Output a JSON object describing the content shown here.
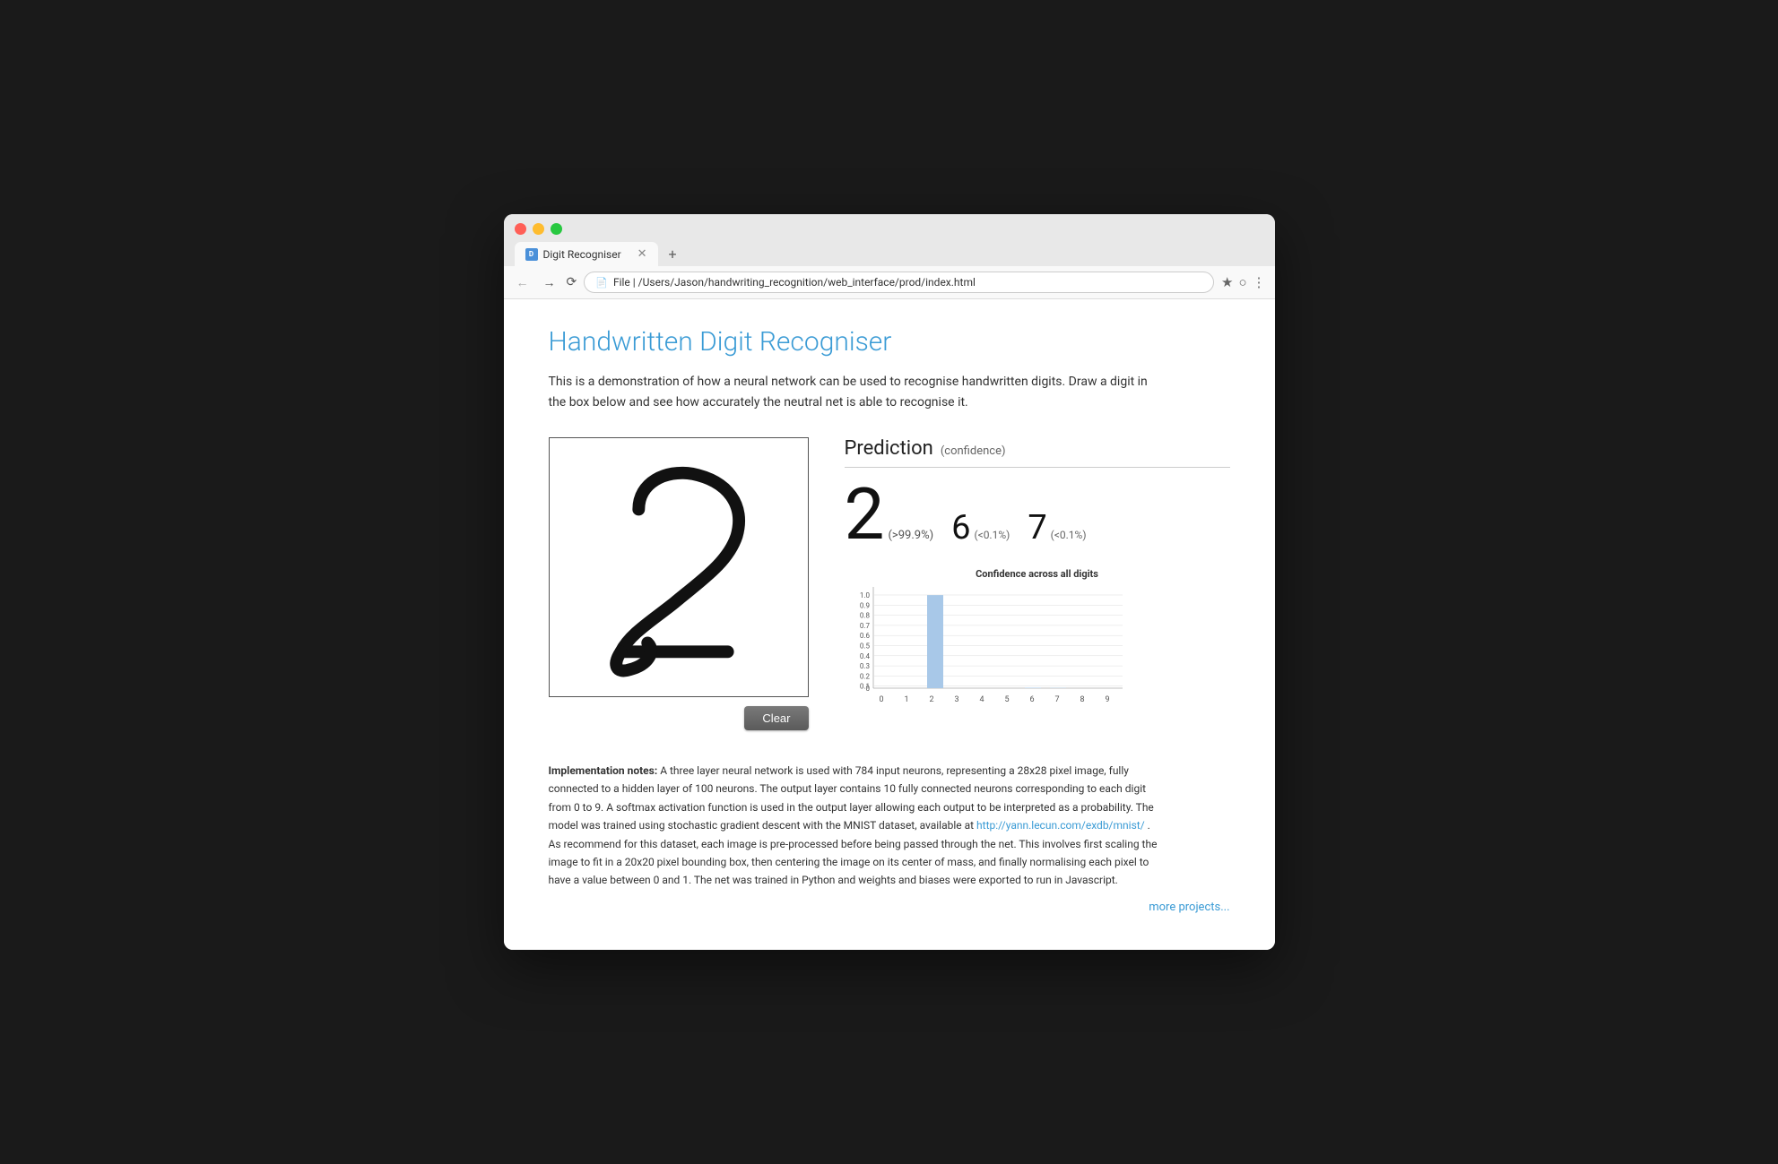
{
  "browser": {
    "tab_label": "Digit Recogniser",
    "address": "/Users/Jason/handwriting_recognition/web_interface/prod/index.html",
    "new_tab_icon": "+"
  },
  "page": {
    "title": "Handwritten Digit Recogniser",
    "description": "This is a demonstration of how a neural network can be used to recognise handwritten digits. Draw a digit in the box below and see how accurately the neutral net is able to recognise it.",
    "prediction": {
      "label": "Prediction",
      "confidence_label": "(confidence)",
      "primary_digit": "2",
      "primary_confidence": "(>99.9%)",
      "secondary_1_digit": "6",
      "secondary_1_confidence": "(<0.1%)",
      "secondary_2_digit": "7",
      "secondary_2_confidence": "(<0.1%)"
    },
    "chart": {
      "title": "Confidence across all digits",
      "y_labels": [
        "1.0",
        "0.9",
        "0.8",
        "0.7",
        "0.6",
        "0.5",
        "0.4",
        "0.3",
        "0.2",
        "0.1",
        "0"
      ],
      "x_labels": [
        "0",
        "1",
        "2",
        "3",
        "4",
        "5",
        "6",
        "7",
        "8",
        "9"
      ],
      "bars": [
        0,
        0,
        0.999,
        0,
        0,
        0,
        0.0005,
        0.0003,
        0,
        0
      ]
    },
    "clear_button": "Clear",
    "notes": {
      "label": "Implementation notes:",
      "text": " A three layer neural network is used with 784 input neurons, representing a 28x28 pixel image, fully connected to a hidden layer of 100 neurons. The output layer contains 10 fully connected neurons corresponding to each digit from 0 to 9. A softmax activation function is used in the output layer allowing each output to be interpreted as a probability. The model was trained using stochastic gradient descent with the MNIST dataset, available at ",
      "link_text": "http://yann.lecun.com/exdb/mnist/",
      "link_href": "http://yann.lecun.com/exdb/mnist/",
      "text2": ". As recommend for this dataset, each image is pre-processed before being passed through the net. This involves first scaling the image to fit in a 20x20 pixel bounding box, then centering the image on its center of mass, and finally normalising each pixel to have a value between 0 and 1. The net was trained in Python and weights and biases were exported to run in Javascript."
    },
    "more_projects_label": "more projects..."
  }
}
